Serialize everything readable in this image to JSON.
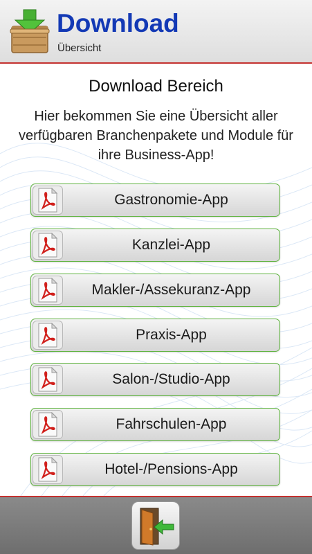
{
  "header": {
    "title": "Download",
    "subtitle": "Übersicht",
    "icon": "download-box-icon"
  },
  "main": {
    "title": "Download Bereich",
    "description": "Hier bekommen Sie eine Übersicht aller verfügbaren Branchenpakete und Module für ihre Business-App!",
    "items": [
      {
        "label": "Gastronomie-App",
        "icon": "pdf-icon"
      },
      {
        "label": "Kanzlei-App",
        "icon": "pdf-icon"
      },
      {
        "label": "Makler-/Assekuranz-App",
        "icon": "pdf-icon"
      },
      {
        "label": "Praxis-App",
        "icon": "pdf-icon"
      },
      {
        "label": "Salon-/Studio-App",
        "icon": "pdf-icon"
      },
      {
        "label": "Fahrschulen-App",
        "icon": "pdf-icon"
      },
      {
        "label": "Hotel-/Pensions-App",
        "icon": "pdf-icon"
      }
    ]
  },
  "footer": {
    "exit_icon": "exit-door-icon"
  },
  "colors": {
    "accent": "#1339b5",
    "divider": "#c4312f",
    "button_border": "#5fb33f",
    "footer_bg": "#7c7c7c"
  }
}
